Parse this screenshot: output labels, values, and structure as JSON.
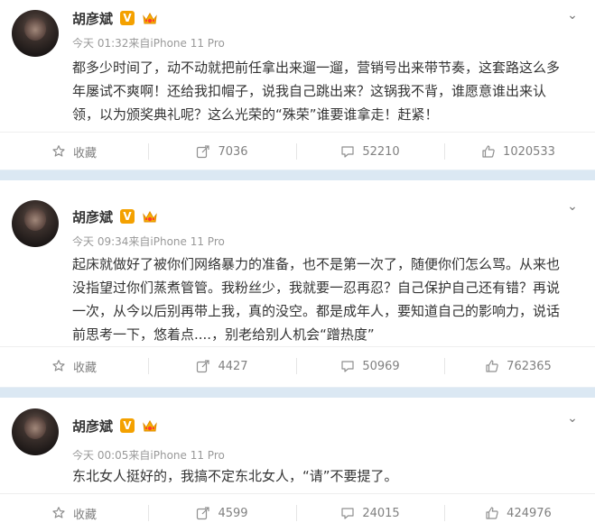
{
  "posts": [
    {
      "name": "胡彦斌",
      "meta": "今天 01:32来自iPhone 11 Pro",
      "text": "都多少时间了，动不动就把前任拿出来遛一遛，营销号出来带节奏，这套路这么多年屡试不爽啊！还给我扣帽子，说我自己跳出来？这锅我不背，谁愿意谁出来认领，以为颁奖典礼呢？这么光荣的“殊荣”谁要谁拿走！赶紧！",
      "actions": {
        "collect": "收藏",
        "repost": "7036",
        "comment": "52210",
        "like": "1020533"
      }
    },
    {
      "name": "胡彦斌",
      "meta": "今天 09:34来自iPhone 11 Pro",
      "text": "起床就做好了被你们网络暴力的准备，也不是第一次了，随便你们怎么骂。从来也没指望过你们蒸煮管管。我粉丝少，我就要一忍再忍？自己保护自己还有错？再说一次，从今以后别再带上我，真的没空。都是成年人，要知道自己的影响力，说话前思考一下，悠着点....，别老给别人机会“蹭热度”",
      "actions": {
        "collect": "收藏",
        "repost": "4427",
        "comment": "50969",
        "like": "762365"
      }
    },
    {
      "name": "胡彦斌",
      "meta": "今天 00:05来自iPhone 11 Pro",
      "text": "东北女人挺好的，我搞不定东北女人，“请”不要提了。",
      "actions": {
        "collect": "收藏",
        "repost": "4599",
        "comment": "24015",
        "like": "424976"
      }
    }
  ],
  "badge": {
    "vip": "V"
  },
  "icons": {
    "collect": "star-outline-icon",
    "repost": "share-arrow-icon",
    "comment": "comment-bubble-icon",
    "like": "thumbs-up-icon",
    "menu": "chevron-down-icon"
  },
  "colors": {
    "separator": "#dbe8f3",
    "vip_badge": "#f4a100",
    "meta_text": "#999999",
    "action_text": "#808080"
  }
}
